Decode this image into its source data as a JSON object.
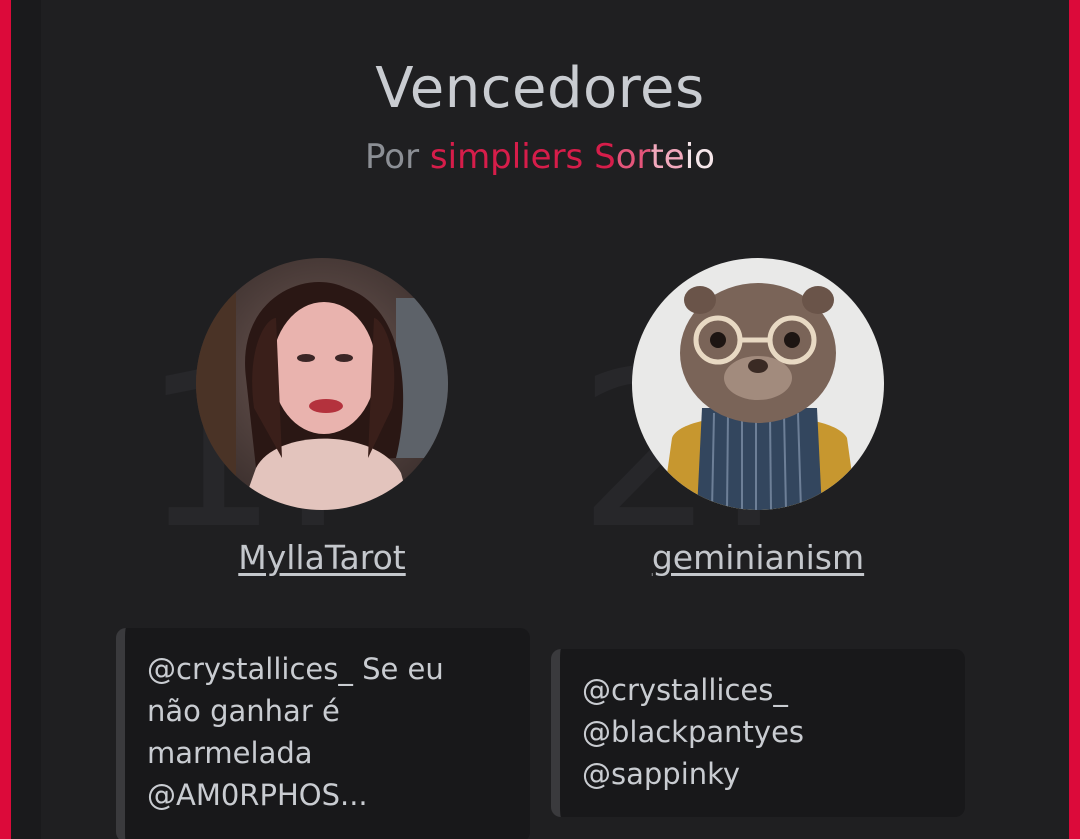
{
  "header": {
    "title": "Vencedores",
    "by": "Por",
    "brand": "simpliers",
    "brand_word": "Sorteio",
    "brand_word_parts": [
      "S",
      "or",
      "te",
      "io"
    ]
  },
  "winners": [
    {
      "rank": "1.",
      "username": "MyllaTarot",
      "comment": "@crystallices_ Se eu\nnão ganhar é\nmarmelada\n@AM0RPHOS..."
    },
    {
      "rank": "2.",
      "username": "geminianism",
      "comment": "@crystallices_\n@blackpantyes\n@sappinky"
    }
  ],
  "colors": {
    "accent": "#dc0a3a",
    "background": "#1f1f21",
    "text": "#c9ccd1"
  }
}
